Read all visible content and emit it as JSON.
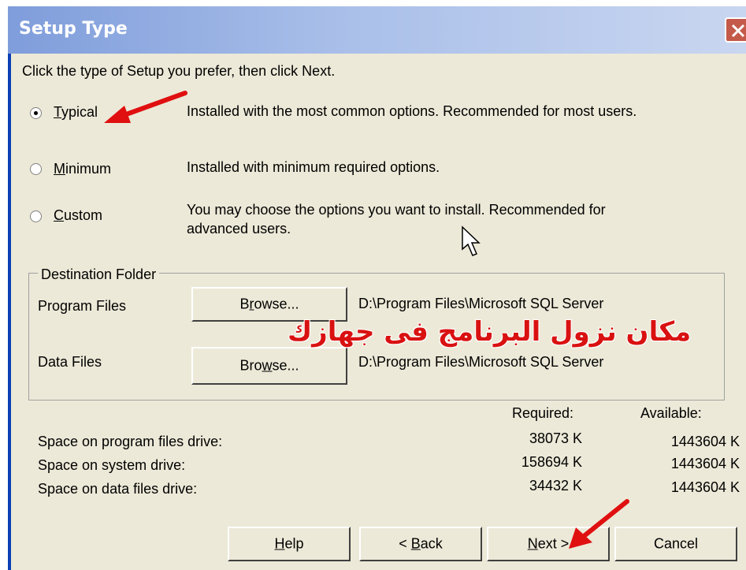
{
  "window": {
    "title": "Setup Type"
  },
  "instruction": "Click the type of Setup you prefer, then click Next.",
  "setup_options": [
    {
      "label": "Typical",
      "accel": "T",
      "rest": "ypical",
      "description": "Installed with the most common options. Recommended for most users.",
      "selected": true
    },
    {
      "label": "Minimum",
      "accel": "M",
      "rest": "inimum",
      "description": "Installed with minimum required options.",
      "selected": false
    },
    {
      "label": "Custom",
      "accel": "C",
      "rest": "ustom",
      "description_line1": "You may choose the options you want to install. Recommended for",
      "description_line2": "advanced users.",
      "selected": false
    }
  ],
  "destination": {
    "legend": "Destination Folder",
    "program_files_label": "Program Files",
    "program_files_button": {
      "before": "B",
      "accel": "r",
      "after": "owse..."
    },
    "program_files_path": "D:\\Program Files\\Microsoft SQL Server",
    "data_files_label": "Data Files",
    "data_files_button": {
      "before": "Bro",
      "accel": "w",
      "after": "se..."
    },
    "data_files_path": "D:\\Program Files\\Microsoft SQL Server"
  },
  "annotation": {
    "text": "مكان نزول البرنامج فى جهازك",
    "color": "#d91111"
  },
  "space": {
    "required_header": "Required:",
    "available_header": "Available:",
    "rows": [
      {
        "label": "Space on program files drive:",
        "required": "38073 K",
        "available": "1443604 K"
      },
      {
        "label": "Space on system drive:",
        "required": "158694 K",
        "available": "1443604 K"
      },
      {
        "label": "Space on data files drive:",
        "required": "34432 K",
        "available": "1443604 K"
      }
    ]
  },
  "buttons": {
    "help": {
      "accel": "H",
      "rest": "elp"
    },
    "back": {
      "prefix": "< ",
      "accel": "B",
      "rest": "ack"
    },
    "next": {
      "accel": "N",
      "rest": "ext >"
    },
    "cancel": "Cancel"
  },
  "colors": {
    "titlebar_start": "#7f9ddb",
    "titlebar_end": "#c9d6f0",
    "dialog_bg": "#ece9d8",
    "arrow": "#e01010"
  }
}
